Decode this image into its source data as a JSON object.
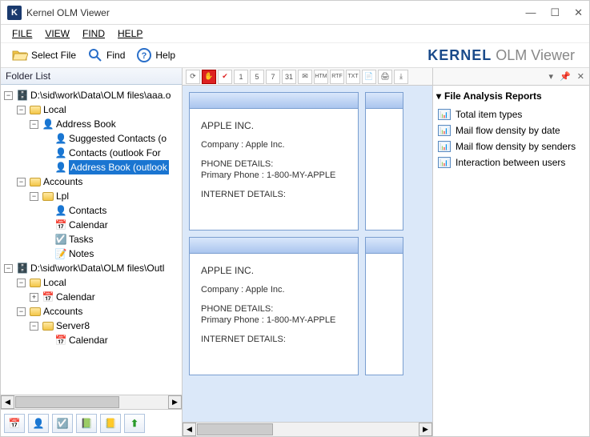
{
  "window": {
    "title": "Kernel OLM Viewer"
  },
  "menu": {
    "file": "FILE",
    "view": "VIEW",
    "find": "FIND",
    "help": "HELP"
  },
  "toolbar": {
    "select_file": "Select File",
    "find": "Find",
    "help": "Help"
  },
  "brand": {
    "strong": "KERNEL",
    "light": " OLM Viewer"
  },
  "folder_list": {
    "header": "Folder List"
  },
  "tree": {
    "root1": "D:\\sid\\work\\Data\\OLM files\\aaa.o",
    "local": "Local",
    "address_book": "Address Book",
    "suggested": "Suggested Contacts (o",
    "contacts_of": "Contacts (outlook For",
    "ab_outlook": "Address Book (outlook",
    "accounts": "Accounts",
    "lpl": "Lpl",
    "contacts": "Contacts",
    "calendar": "Calendar",
    "tasks": "Tasks",
    "notes": "Notes",
    "root2": "D:\\sid\\work\\Data\\OLM files\\Outl",
    "local2": "Local",
    "calendar2": "Calendar",
    "accounts2": "Accounts",
    "server8": "Server8",
    "calendar3": "Calendar"
  },
  "cards": [
    {
      "title": "APPLE INC.",
      "company_label": "Company :",
      "company": "Apple Inc.",
      "phone_header": "PHONE DETAILS:",
      "phone_label": "Primary Phone :",
      "phone": "1-800-MY-APPLE",
      "internet_header": "INTERNET DETAILS:"
    },
    {
      "title": "APPLE INC.",
      "company_label": "Company :",
      "company": "Apple Inc.",
      "phone_header": "PHONE DETAILS:",
      "phone_label": "Primary Phone :",
      "phone": "1-800-MY-APPLE",
      "internet_header": "INTERNET DETAILS:"
    }
  ],
  "center_toolbar": {
    "b1": "1",
    "b5": "5",
    "b7": "7",
    "b31": "31"
  },
  "reports": {
    "title": "File Analysis Reports",
    "items": [
      "Total item types",
      "Mail flow density by date",
      "Mail flow density by senders",
      "Interaction between users"
    ]
  }
}
